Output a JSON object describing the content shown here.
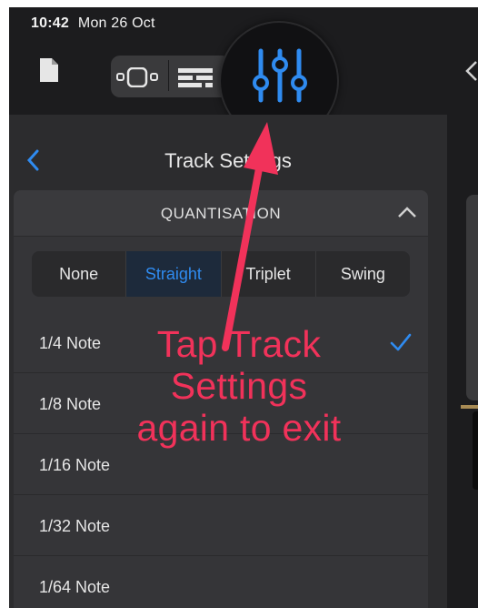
{
  "status_bar": {
    "time": "10:42",
    "date": "Mon 26 Oct"
  },
  "toolbar": {
    "icons": [
      "document-icon",
      "track-view-icon",
      "mixer-icon",
      "track-settings-icon"
    ]
  },
  "panel": {
    "title": "Track Settings"
  },
  "quantisation": {
    "title": "QUANTISATION",
    "segments": [
      "None",
      "Straight",
      "Triplet",
      "Swing"
    ],
    "selected_segment": "Straight",
    "options": [
      "1/4 Note",
      "1/8 Note",
      "1/16 Note",
      "1/32 Note",
      "1/64 Note"
    ],
    "selected_option": "1/4 Note"
  },
  "annotation": {
    "line1": "Tap Track",
    "line2": "Settings",
    "line3": "again to exit"
  },
  "colors": {
    "accent": "#2f8bf0",
    "annotation": "#f1325a",
    "background": "#1c1c1e",
    "panel": "#2c2c2e"
  }
}
